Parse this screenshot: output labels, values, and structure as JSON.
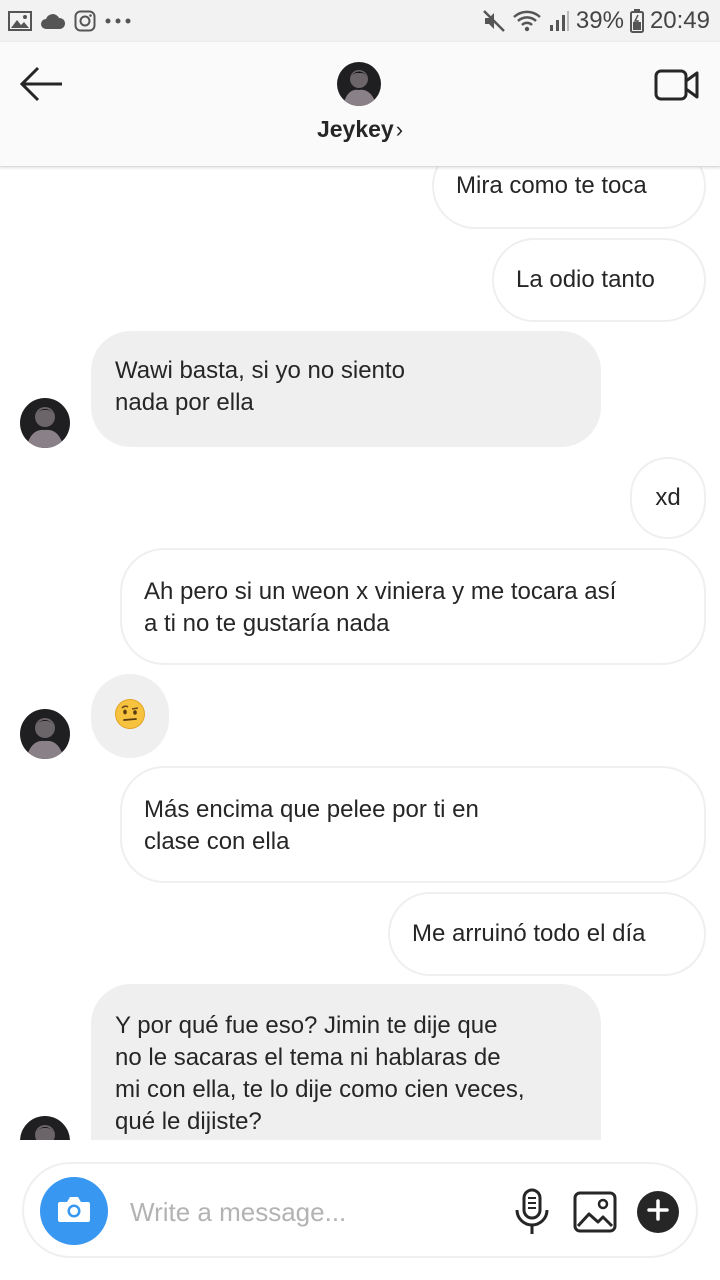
{
  "status_bar": {
    "battery": "39%",
    "time": "20:49",
    "left_icons": [
      "gallery-icon",
      "cloud-icon",
      "instagram-icon",
      "more-icon"
    ],
    "right_icons": [
      "mute-icon",
      "wifi-icon",
      "signal-icon",
      "battery-icon"
    ]
  },
  "header": {
    "name": "Jeykey",
    "chevron": "›",
    "back_icon": "arrow-left-icon",
    "video_icon": "video-camera-icon"
  },
  "messages": [
    {
      "direction": "out",
      "text": "Mira como te toca"
    },
    {
      "direction": "out",
      "text": "La odio tanto"
    },
    {
      "direction": "in",
      "lines": [
        "Wawi basta, si yo no siento",
        "nada por ella"
      ]
    },
    {
      "direction": "out",
      "text": "xd"
    },
    {
      "direction": "out",
      "lines": [
        "Ah pero si un weon x viniera y me tocara así",
        "a ti no te gustaría nada"
      ]
    },
    {
      "direction": "in",
      "emoji": "🤨"
    },
    {
      "direction": "out",
      "lines": [
        "Más encima que pelee por ti en",
        "clase con ella"
      ]
    },
    {
      "direction": "out",
      "text": "Me arruinó todo el día"
    },
    {
      "direction": "in",
      "lines": [
        "Y por qué fue eso? Jimin te dije que",
        "no le sacaras el tema ni hablaras de",
        "mi con ella, te lo dije como cien veces,",
        "qué le dijiste?"
      ]
    }
  ],
  "composer": {
    "placeholder": "Write a message...",
    "value": "",
    "icons": [
      "camera-icon",
      "microphone-icon",
      "gallery-icon",
      "plus-icon"
    ]
  },
  "colors": {
    "accent": "#3897f0",
    "incoming_bubble": "#efefef",
    "outgoing_border": "#efefef",
    "text": "#262626"
  }
}
